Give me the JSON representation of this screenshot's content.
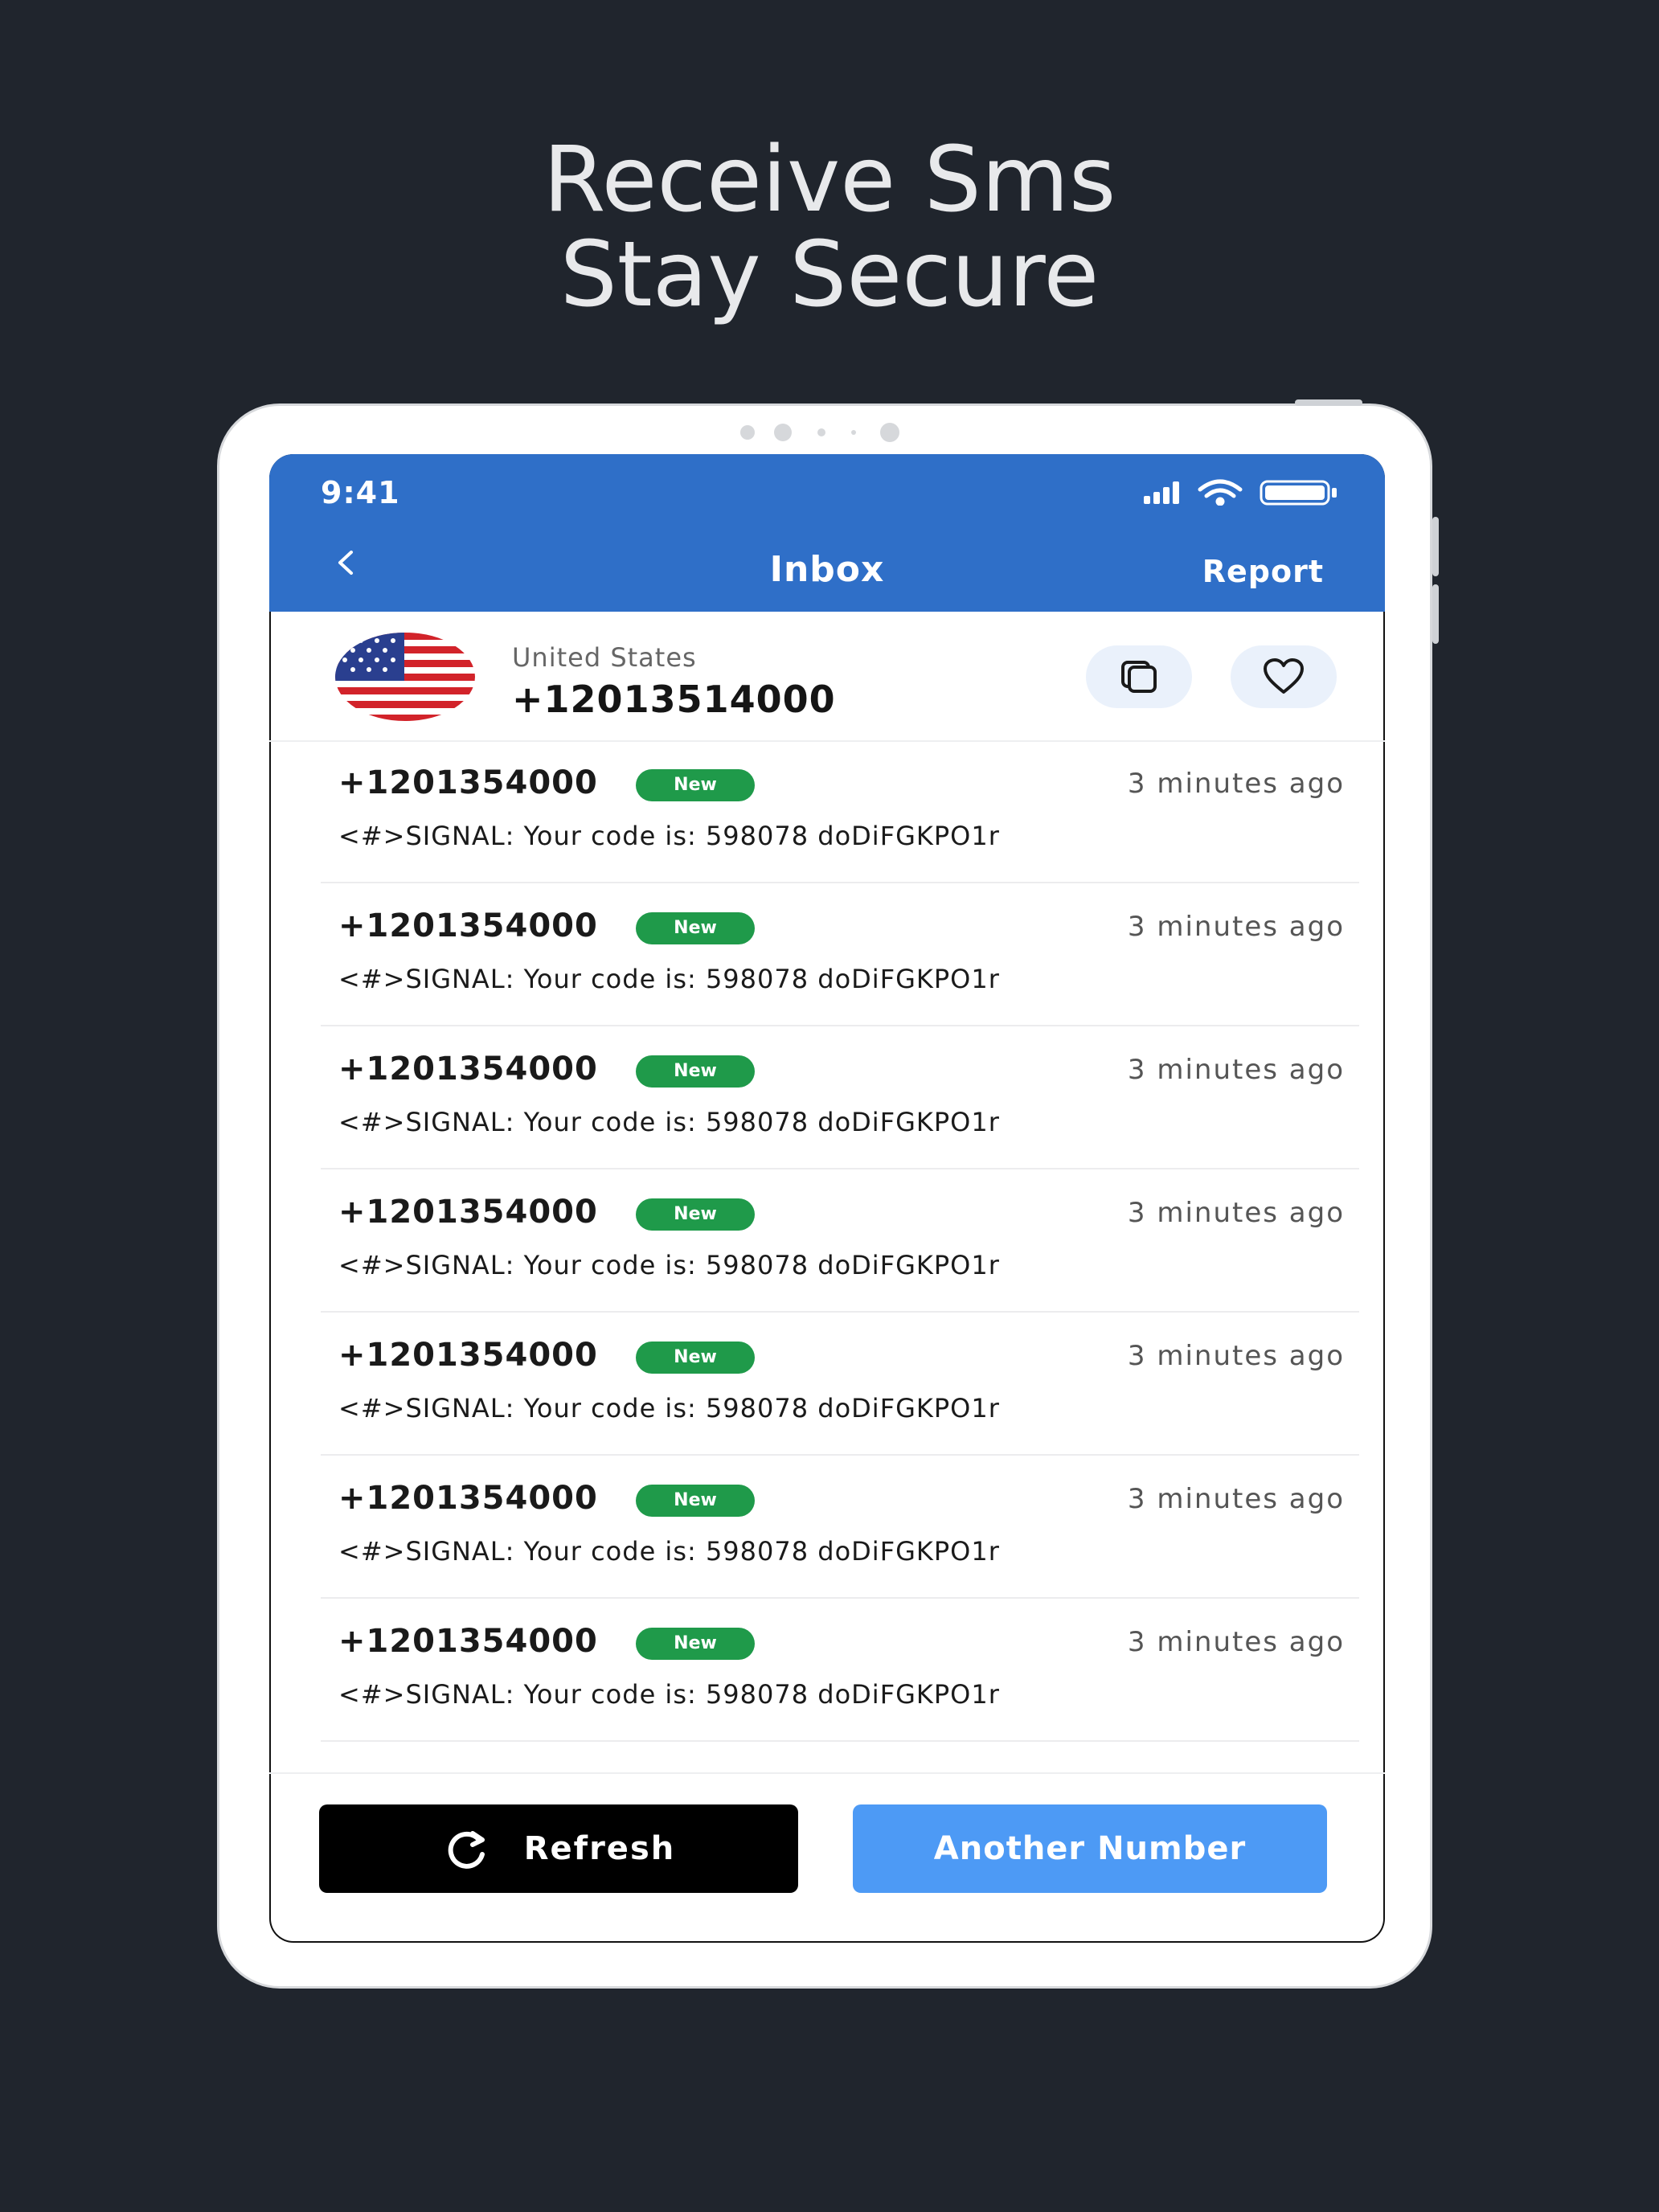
{
  "headline": {
    "line1": "Receive Sms",
    "line2": "Stay Secure"
  },
  "status_bar": {
    "time": "9:41",
    "icons": [
      "signal-icon",
      "wifi-icon",
      "battery-icon"
    ]
  },
  "nav": {
    "back_icon": "chevron-left-icon",
    "title": "Inbox",
    "report_label": "Report"
  },
  "number_card": {
    "country": "United States",
    "phone": "+12013514000",
    "flag_icon": "us-flag-icon",
    "copy_icon": "copy-icon",
    "favorite_icon": "heart-icon"
  },
  "messages": [
    {
      "sender": "+1201354000",
      "badge": "New",
      "time": "3 minutes ago",
      "body": "<#>SIGNAL: Your code is: 598078 doDiFGKPO1r"
    },
    {
      "sender": "+1201354000",
      "badge": "New",
      "time": "3 minutes ago",
      "body": "<#>SIGNAL: Your code is: 598078 doDiFGKPO1r"
    },
    {
      "sender": "+1201354000",
      "badge": "New",
      "time": "3 minutes ago",
      "body": "<#>SIGNAL: Your code is: 598078 doDiFGKPO1r"
    },
    {
      "sender": "+1201354000",
      "badge": "New",
      "time": "3 minutes ago",
      "body": "<#>SIGNAL: Your code is: 598078 doDiFGKPO1r"
    },
    {
      "sender": "+1201354000",
      "badge": "New",
      "time": "3 minutes ago",
      "body": "<#>SIGNAL: Your code is: 598078 doDiFGKPO1r"
    },
    {
      "sender": "+1201354000",
      "badge": "New",
      "time": "3 minutes ago",
      "body": "<#>SIGNAL: Your code is: 598078 doDiFGKPO1r"
    },
    {
      "sender": "+1201354000",
      "badge": "New",
      "time": "3 minutes ago",
      "body": "<#>SIGNAL: Your code is: 598078 doDiFGKPO1r"
    }
  ],
  "actions": {
    "refresh_label": "Refresh",
    "refresh_icon": "refresh-icon",
    "another_label": "Another Number"
  },
  "colors": {
    "background": "#20252d",
    "header": "#2f6fc8",
    "badge": "#1f9a4a",
    "another_button": "#4d9af5"
  }
}
